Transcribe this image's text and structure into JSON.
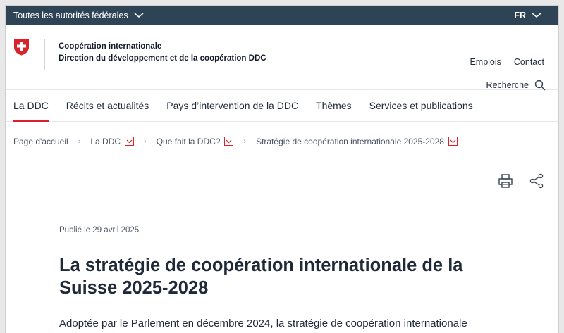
{
  "topbar": {
    "authorities_label": "Toutes les autorités fédérales",
    "language": "FR"
  },
  "header": {
    "org_line1": "Coopération internationale",
    "org_line2": "Direction du développement et de la coopération DDC",
    "links": [
      "Emplois",
      "Contact"
    ],
    "search_label": "Recherche"
  },
  "nav": {
    "items": [
      "La DDC",
      "Récits et actualités",
      "Pays d’intervention de la DDC",
      "Thèmes",
      "Services et publications"
    ],
    "active_index": 0
  },
  "breadcrumb": {
    "items": [
      "Page d'accueil",
      "La DDC",
      "Que fait la DDC?",
      "Stratégie de coopération internationale 2025-2028"
    ]
  },
  "article": {
    "published": "Publié le 29 avril 2025",
    "title_line1": "La stratégie de coopération internationale de la",
    "title_line2": "Suisse 2025-2028",
    "lead": "Adoptée par le Parlement en décembre 2024, la stratégie de coopération internationale"
  },
  "icons": {
    "print": "printer-icon",
    "share": "share-icon",
    "search": "search-icon"
  },
  "colors": {
    "topbar": "#2f4356",
    "accent": "#d8232a"
  }
}
